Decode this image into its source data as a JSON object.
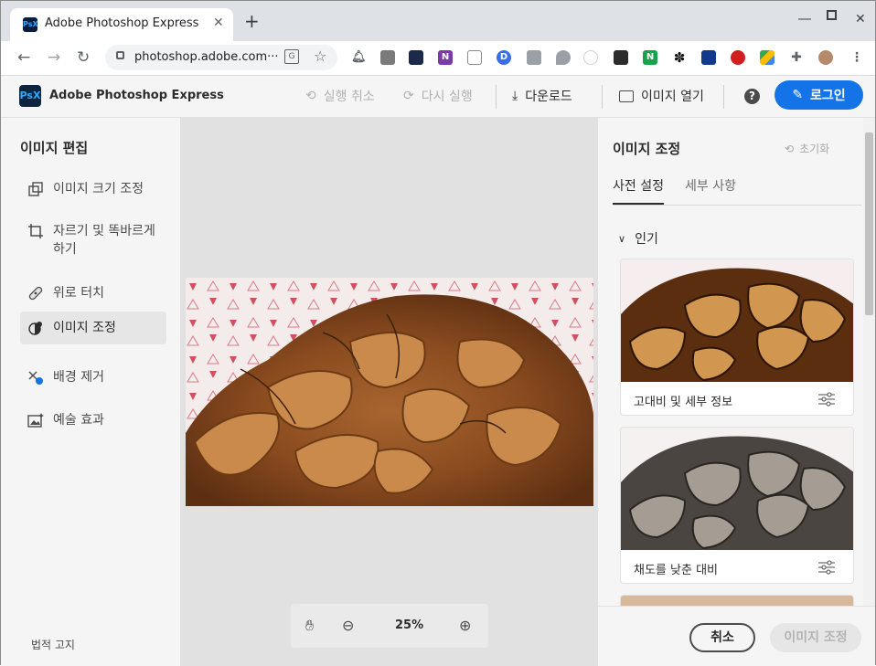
{
  "browser": {
    "tab_title": "Adobe Photoshop Express",
    "tab_favicon": "PsX",
    "url": "photoshop.adobe.com···",
    "translate_glyph": "G"
  },
  "app": {
    "logo_text": "PsX",
    "name": "Adobe Photoshop Express",
    "undo_label": "실행 취소",
    "redo_label": "다시 실행",
    "download_label": "다운로드",
    "open_label": "이미지 열기",
    "help_glyph": "?",
    "login_label": "로그인"
  },
  "left_panel": {
    "title": "이미지 편집",
    "items": [
      {
        "label": "이미지 크기 조정",
        "icon": "resize-icon"
      },
      {
        "label": "자르기 및 똑바르게 하기",
        "icon": "crop-icon"
      },
      {
        "label": "위로 터치",
        "icon": "bandage-icon"
      },
      {
        "label": "이미지 조정",
        "icon": "adjust-icon"
      },
      {
        "label": "배경 제거",
        "icon": "background-remove-icon"
      },
      {
        "label": "예술 효과",
        "icon": "artistic-effect-icon"
      }
    ],
    "legal": "법적 고지"
  },
  "canvas": {
    "zoom": "25%"
  },
  "right_panel": {
    "title": "이미지 조정",
    "reset_label": "초기화",
    "tabs": [
      "사전 설정",
      "세부 사항"
    ],
    "section": "인기",
    "presets": [
      {
        "label": "고대비 및 세부 정보"
      },
      {
        "label": "채도를 낮춘 대비"
      }
    ],
    "cancel_label": "취소",
    "apply_label": "이미지 조정"
  },
  "colors": {
    "accent": "#1473e6",
    "panel_bg": "#f5f5f5",
    "canvas_bg": "#e1e1e1"
  }
}
